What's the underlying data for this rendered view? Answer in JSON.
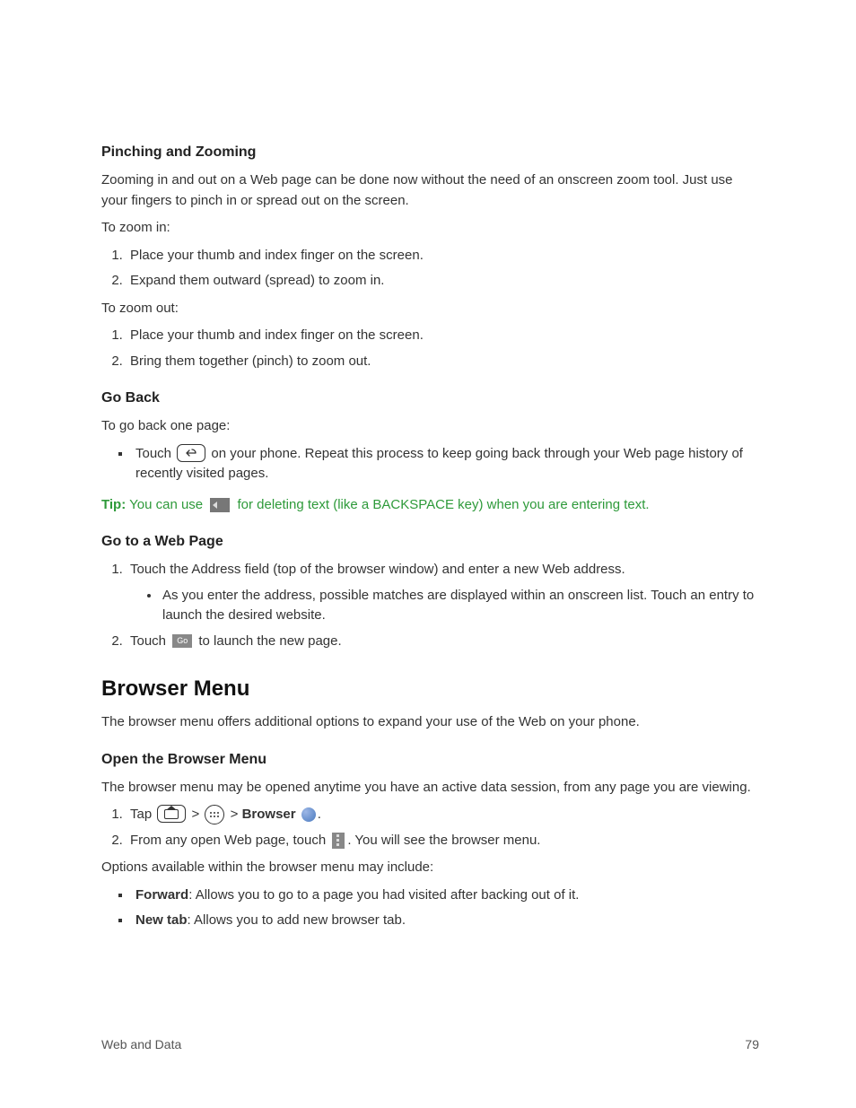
{
  "section1": {
    "heading": "Pinching and Zooming",
    "intro": "Zooming in and out on a Web page can be done now without the need of an onscreen zoom tool. Just use your fingers to pinch in or spread out on the screen.",
    "zoom_in_label": "To zoom in:",
    "zoom_in_steps": [
      "Place your thumb and index finger on the screen.",
      "Expand them outward (spread) to zoom in."
    ],
    "zoom_out_label": "To zoom out:",
    "zoom_out_steps": [
      "Place your thumb and index finger on the screen.",
      "Bring them together (pinch) to zoom out."
    ]
  },
  "section2": {
    "heading": "Go Back",
    "intro": "To go back one page:",
    "bullet_pre": "Touch ",
    "bullet_post": " on your phone. Repeat this process to keep going back through your Web page history of recently visited pages.",
    "tip_label": "Tip:",
    "tip_pre": " You can use ",
    "tip_post": " for deleting text (like a BACKSPACE key) when you are entering text."
  },
  "section3": {
    "heading": "Go to a Web Page",
    "step1": "Touch the Address field (top of the browser window) and enter a new Web address.",
    "step1_sub": "As you enter the address, possible matches are displayed within an onscreen list. Touch an entry to launch the desired website.",
    "step2_pre": "Touch ",
    "step2_post": " to launch the new page.",
    "go_label": "Go"
  },
  "browser_menu": {
    "heading": "Browser Menu",
    "intro": "The browser menu offers additional options to expand your use of the Web on your phone."
  },
  "section4": {
    "heading": "Open the Browser Menu",
    "intro": "The browser menu may be opened anytime you have an active data session, from any page you are viewing.",
    "step1_pre": "Tap ",
    "gt": " > ",
    "browser_label": "Browser",
    "period": ".",
    "step2_pre": "From any open Web page, touch ",
    "step2_post": ". You will see the browser menu.",
    "options_intro": "Options available within the browser menu may include:",
    "opt1_bold": "Forward",
    "opt1_rest": ": Allows you to go to a page you had visited after backing out of it.",
    "opt2_bold": "New tab",
    "opt2_rest": ": Allows you to add new browser tab."
  },
  "footer": {
    "section": "Web and Data",
    "page": "79"
  }
}
